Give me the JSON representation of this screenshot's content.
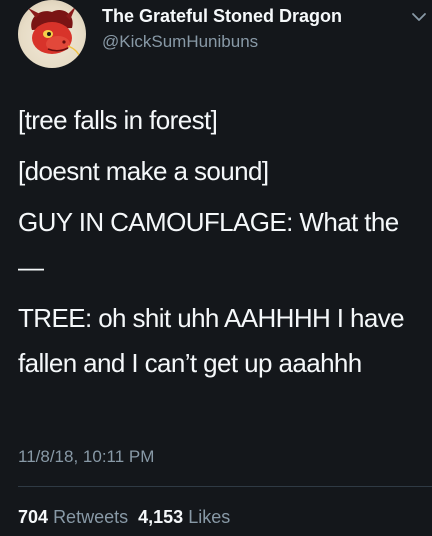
{
  "user": {
    "display_name": "The Grateful Stoned Dragon",
    "handle": "@KickSumHunibuns",
    "avatar_icon": "dragon-avatar-icon"
  },
  "tweet": {
    "lines": [
      "[tree falls in forest]",
      "[doesnt make a sound]",
      "GUY IN CAMOUFLAGE: What the—",
      "TREE: oh shit uhh AAHHHH I have fallen and I can’t get up aaahhh"
    ],
    "timestamp": "11/8/18, 10:11 PM"
  },
  "stats": {
    "retweets_count": "704",
    "retweets_label": "Retweets",
    "likes_count": "4,153",
    "likes_label": "Likes"
  },
  "colors": {
    "background": "#14171b",
    "primary_text": "#f5f8fa",
    "secondary_text": "#8899a6"
  }
}
